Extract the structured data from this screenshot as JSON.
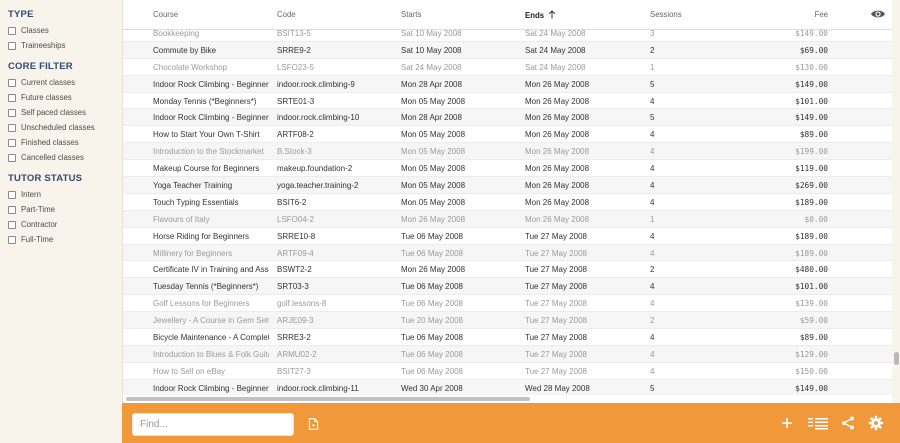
{
  "sidebar": {
    "type": {
      "title": "TYPE",
      "options": [
        "Classes",
        "Traineeships"
      ]
    },
    "core_filter": {
      "title": "CORE FILTER",
      "options": [
        "Current classes",
        "Future classes",
        "Self paced classes",
        "Unscheduled classes",
        "Finished classes",
        "Cancelled classes"
      ]
    },
    "tutor_status": {
      "title": "TUTOR STATUS",
      "options": [
        "Intern",
        "Part-Time",
        "Contractor",
        "Full-Time"
      ]
    }
  },
  "table": {
    "headers": {
      "course": "Course",
      "code": "Code",
      "starts": "Starts",
      "ends": "Ends",
      "sessions": "Sessions",
      "fee": "Fee"
    },
    "sorted_by": "ends",
    "rows": [
      {
        "course": "Bookkeeping",
        "code": "BSIT13-5",
        "starts": "Sat 10 May 2008",
        "ends": "Sat 24 May 2008",
        "sessions": "3",
        "fee": "$149.00",
        "dim": true
      },
      {
        "course": "Commute by Bike",
        "code": "SRRE9-2",
        "starts": "Sat 10 May 2008",
        "ends": "Sat 24 May 2008",
        "sessions": "2",
        "fee": "$69.00",
        "dim": false
      },
      {
        "course": "Chocolate Workshop",
        "code": "LSFO23-5",
        "starts": "Sat 24 May 2008",
        "ends": "Sat 24 May 2008",
        "sessions": "1",
        "fee": "$130.00",
        "dim": true
      },
      {
        "course": "Indoor Rock Climbing - Beginner",
        "code": "indoor.rock.climbing-9",
        "starts": "Mon 28 Apr 2008",
        "ends": "Mon 26 May 2008",
        "sessions": "5",
        "fee": "$149.00",
        "dim": false
      },
      {
        "course": "Monday Tennis (*Beginners*)",
        "code": "SRTE01-3",
        "starts": "Mon 05 May 2008",
        "ends": "Mon 26 May 2008",
        "sessions": "4",
        "fee": "$101.00",
        "dim": false
      },
      {
        "course": "Indoor Rock Climbing - Beginner",
        "code": "indoor.rock.climbing-10",
        "starts": "Mon 28 Apr 2008",
        "ends": "Mon 26 May 2008",
        "sessions": "5",
        "fee": "$149.00",
        "dim": false
      },
      {
        "course": "How to Start Your Own T-Shirt",
        "code": "ARTF08-2",
        "starts": "Mon 05 May 2008",
        "ends": "Mon 26 May 2008",
        "sessions": "4",
        "fee": "$89.00",
        "dim": false
      },
      {
        "course": "Introduction to the Stockmarket",
        "code": "B.Stock-3",
        "starts": "Mon 05 May 2008",
        "ends": "Mon 26 May 2008",
        "sessions": "4",
        "fee": "$199.00",
        "dim": true
      },
      {
        "course": "Makeup Course for Beginners",
        "code": "makeup.foundation-2",
        "starts": "Mon 05 May 2008",
        "ends": "Mon 26 May 2008",
        "sessions": "4",
        "fee": "$119.00",
        "dim": false
      },
      {
        "course": "Yoga Teacher Training",
        "code": "yoga.teacher.training-2",
        "starts": "Mon 05 May 2008",
        "ends": "Mon 26 May 2008",
        "sessions": "4",
        "fee": "$269.00",
        "dim": false
      },
      {
        "course": "Touch Typing Essentials",
        "code": "BSIT6-2",
        "starts": "Mon 05 May 2008",
        "ends": "Mon 26 May 2008",
        "sessions": "4",
        "fee": "$189.00",
        "dim": false
      },
      {
        "course": "Flavours of Italy",
        "code": "LSFO04-2",
        "starts": "Mon 26 May 2008",
        "ends": "Mon 26 May 2008",
        "sessions": "1",
        "fee": "$0.00",
        "dim": true
      },
      {
        "course": "Horse Riding for Beginners",
        "code": "SRRE10-8",
        "starts": "Tue 06 May 2008",
        "ends": "Tue 27 May 2008",
        "sessions": "4",
        "fee": "$189.00",
        "dim": false
      },
      {
        "course": "Millinery for Beginners",
        "code": "ARTF09-4",
        "starts": "Tue 06 May 2008",
        "ends": "Tue 27 May 2008",
        "sessions": "4",
        "fee": "$189.00",
        "dim": true
      },
      {
        "course": "Certificate IV in Training and Assessment",
        "code": "BSWT2-2",
        "starts": "Mon 26 May 2008",
        "ends": "Tue 27 May 2008",
        "sessions": "2",
        "fee": "$480.00",
        "dim": false
      },
      {
        "course": "Tuesday Tennis (*Beginners*)",
        "code": "SRT03-3",
        "starts": "Tue 06 May 2008",
        "ends": "Tue 27 May 2008",
        "sessions": "4",
        "fee": "$101.00",
        "dim": false
      },
      {
        "course": "Golf Lessons for Beginners",
        "code": "golf.lessons-8",
        "starts": "Tue 06 May 2008",
        "ends": "Tue 27 May 2008",
        "sessions": "4",
        "fee": "$139.00",
        "dim": true
      },
      {
        "course": "Jewellery - A Course in Gem Setting",
        "code": "ARJE09-3",
        "starts": "Tue 20 May 2008",
        "ends": "Tue 27 May 2008",
        "sessions": "2",
        "fee": "$59.00",
        "dim": true
      },
      {
        "course": "Bicycle Maintenance - A Complete Guide",
        "code": "SRRE3-2",
        "starts": "Tue 06 May 2008",
        "ends": "Tue 27 May 2008",
        "sessions": "4",
        "fee": "$89.00",
        "dim": false
      },
      {
        "course": "Introduction to Blues & Folk Guitar",
        "code": "ARMU02-2",
        "starts": "Tue 06 May 2008",
        "ends": "Tue 27 May 2008",
        "sessions": "4",
        "fee": "$129.00",
        "dim": true
      },
      {
        "course": "How to Sell on eBay",
        "code": "BSIT27-3",
        "starts": "Tue 06 May 2008",
        "ends": "Tue 27 May 2008",
        "sessions": "4",
        "fee": "$150.00",
        "dim": true
      },
      {
        "course": "Indoor Rock Climbing - Beginner",
        "code": "indoor.rock.climbing-11",
        "starts": "Wed 30 Apr 2008",
        "ends": "Wed 28 May 2008",
        "sessions": "5",
        "fee": "$149.00",
        "dim": false
      }
    ]
  },
  "footer": {
    "find_placeholder": "Find...",
    "icons": [
      "document-icon",
      "plus-icon",
      "list-view-icon",
      "share-icon",
      "gear-icon"
    ]
  },
  "colors": {
    "accent": "#f0983a",
    "sidebar_bg": "#f8f4ec",
    "section_title": "#2e4a73"
  }
}
